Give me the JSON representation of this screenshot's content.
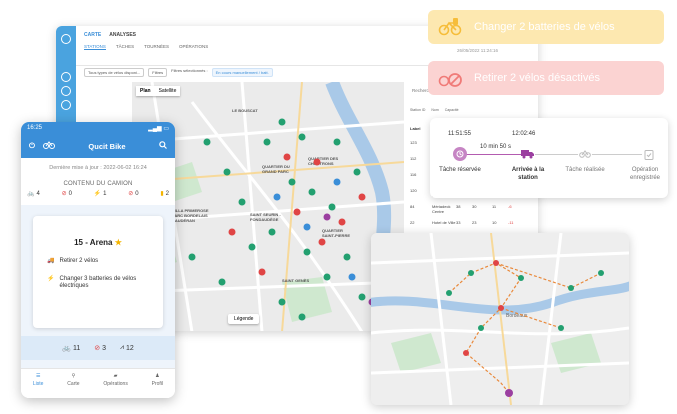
{
  "dashboard": {
    "tabs": [
      "CARTE",
      "ANALYSES"
    ],
    "subtabs": [
      "STATIONS",
      "TÂCHES",
      "TOURNÉES",
      "OPÉRATIONS"
    ],
    "date": "26/05/2022 11:24:16",
    "filters": [
      "Tous types de vélos disponi...",
      "Filtres",
      "Filtres sélectionnés :",
      "En cours manuellement / batt."
    ],
    "map_tabs": [
      "Plan",
      "Satellite"
    ],
    "map_districts": [
      "QUARTIER DU GRAND PARC",
      "QUARTIER DES CHARTRONS",
      "SAINT SEURIN - FONDAUDÈGE",
      "VILLE PRIMEROSE PARC BORDELAIS CAUDÉRAN",
      "QUARTIER SAINT-PIERRE",
      "SAINT GENÈS",
      "LE BOUSCAT"
    ],
    "legend_label": "Légende",
    "table": {
      "search_placeholder": "Rechercher",
      "filters": [
        "Station ID",
        "Nom",
        "Capacité"
      ],
      "col_headers": [
        "Label",
        "Nom",
        "Cap.",
        "Vélos",
        "À dépl.",
        "Δ"
      ],
      "rows": [
        [
          "123",
          "Porte de Bourgogne",
          "38",
          "",
          "",
          ""
        ],
        [
          "112",
          "Arts et Métiers",
          "45",
          "",
          "",
          ""
        ],
        [
          "116",
          "Montaigne Montesquieu",
          "40",
          "",
          "",
          ""
        ],
        [
          "120",
          "St Louis Hauseman",
          "38",
          "",
          "",
          ""
        ],
        [
          "84",
          "Mériadeck Centre",
          "38",
          "30",
          "11",
          "-6"
        ],
        [
          "22",
          "Hotel de Ville",
          "33",
          "23",
          "10",
          "-11"
        ],
        [
          "16",
          "Fusterie",
          "38",
          "25",
          "14",
          "-3"
        ]
      ]
    }
  },
  "phone": {
    "time": "16:25",
    "app_title": "Qucit Bike",
    "last_update": "Dernière mise à jour : 2022-06-02 16:24",
    "truck_title": "CONTENU DU CAMION",
    "truck_counts": [
      "4",
      "0",
      "1",
      "0",
      "2"
    ],
    "card": {
      "title": "15 - Arena",
      "tasks": [
        "Retirer 2 vélos",
        "Changer 3 batteries de vélos électriques"
      ]
    },
    "footer_counts": [
      "11",
      "3",
      "12"
    ],
    "nav": [
      "Liste",
      "Carte",
      "Opérations",
      "Profil"
    ]
  },
  "notifications": [
    {
      "text": "Changer 2 batteries de vélos",
      "color": "#f6bd3a"
    },
    {
      "text": "Retirer 2 vélos désactivés",
      "color": "#f07b78"
    }
  ],
  "timeline": {
    "start_time": "11:51:55",
    "end_time": "12:02:46",
    "duration": "10 min 50 s",
    "steps": [
      {
        "label": "Tâche réservée"
      },
      {
        "label": "Arrivée à la station"
      },
      {
        "label": "Tâche réalisée"
      },
      {
        "label": "Opération enregistrée"
      }
    ]
  },
  "route_map": {
    "city": "Bordeaux"
  },
  "colors": {
    "brand_blue": "#3a8ed8",
    "purple": "#9b3fa0",
    "station_green": "#23a070",
    "station_red": "#e04545",
    "route_orange": "#e9893b"
  },
  "icons": [
    "power-icon",
    "bike-icon",
    "search-icon",
    "truck-icon",
    "list-icon",
    "map-pin-icon",
    "person-icon",
    "star-icon",
    "battery-icon",
    "clipboard-icon"
  ]
}
